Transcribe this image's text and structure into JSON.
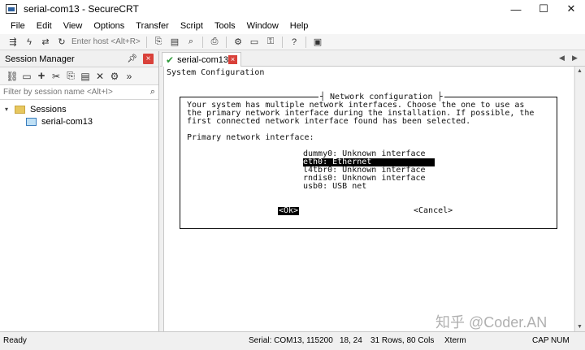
{
  "window": {
    "title": "serial-com13 - SecureCRT",
    "minimize_glyph": "—",
    "maximize_glyph": "☐",
    "close_glyph": "✕"
  },
  "menu": [
    "File",
    "Edit",
    "View",
    "Options",
    "Transfer",
    "Script",
    "Tools",
    "Window",
    "Help"
  ],
  "toolbar": {
    "host_placeholder": "Enter host <Alt+R>"
  },
  "session_manager": {
    "title": "Session Manager",
    "filter_placeholder": "Filter by session name <Alt+I>",
    "tree": {
      "folder": "Sessions",
      "session": "serial-com13"
    }
  },
  "tab": {
    "label": "serial-com13"
  },
  "terminal": {
    "header": "System Configuration",
    "dialog_title": "┤ Network configuration ├",
    "message_lines": [
      "Your system has multiple network interfaces. Choose the one to use as",
      "the primary network interface during the installation. If possible, the",
      "first connected network interface found has been selected."
    ],
    "prompt": "Primary network interface:",
    "interfaces": [
      "dummy0: Unknown interface",
      "eth0: Ethernet",
      "l4tbr0: Unknown interface",
      "rndis0: Unknown interface",
      "usb0: USB net"
    ],
    "ok_label": "<Ok>",
    "cancel_label": "<Cancel>"
  },
  "status": {
    "ready": "Ready",
    "connection": "Serial: COM13, 115200",
    "cursor": "18,  24",
    "size": "31 Rows, 80 Cols",
    "term": "Xterm",
    "cap": "CAP",
    "num": "NUM"
  },
  "watermark": "知乎 @Coder.AN"
}
